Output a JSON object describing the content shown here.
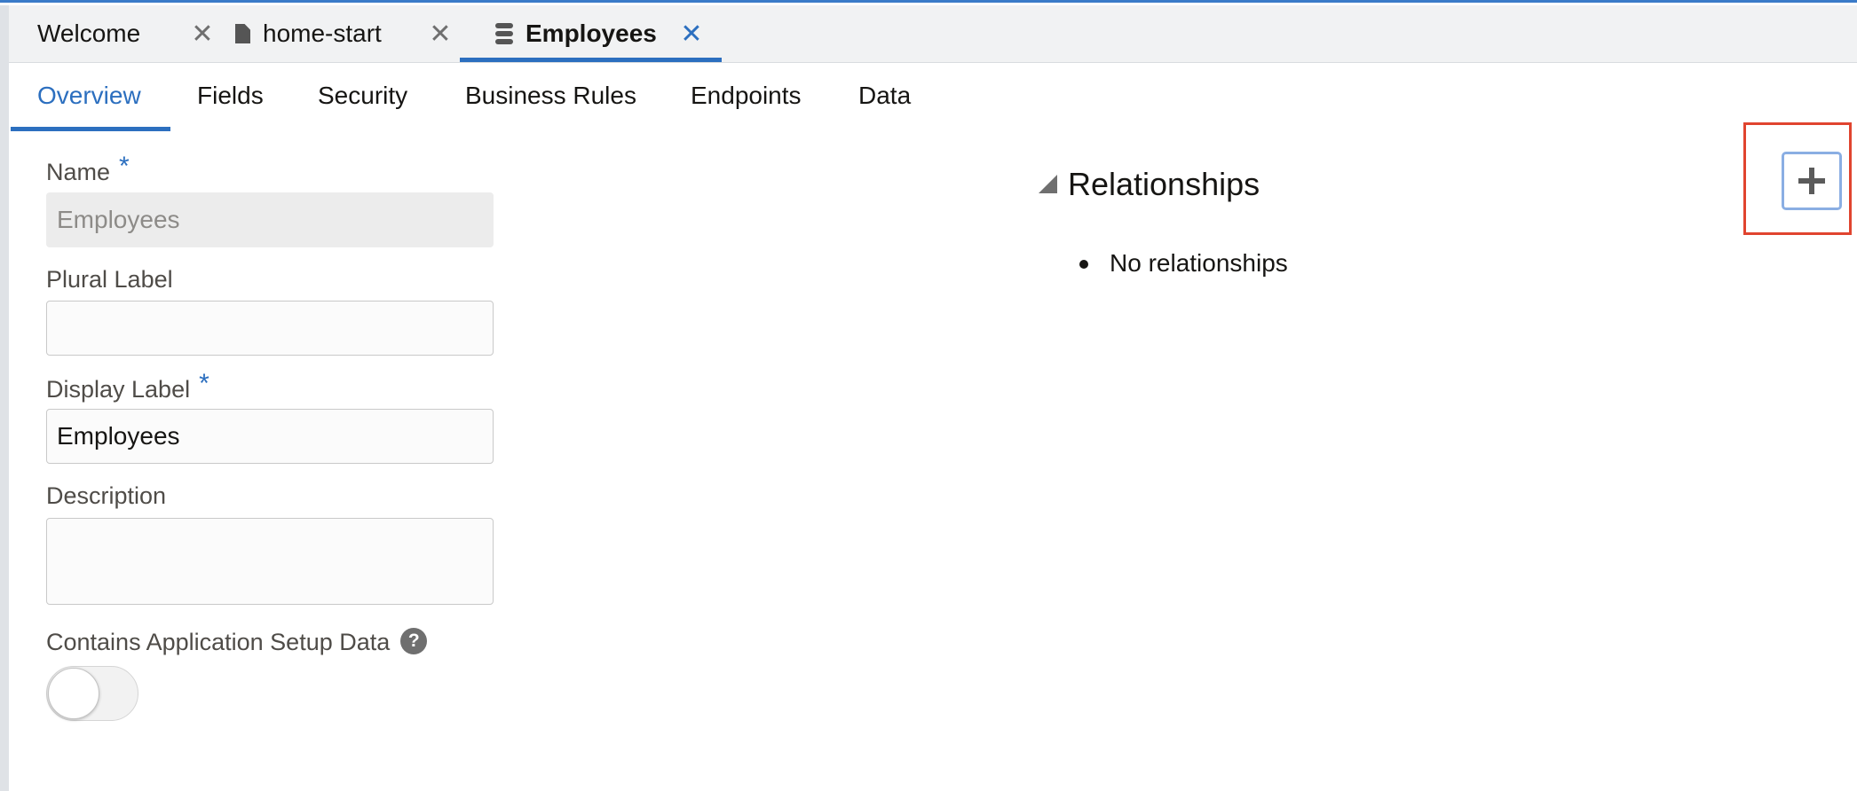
{
  "file_tabs": [
    {
      "label": "Welcome",
      "icon": null,
      "active": false
    },
    {
      "label": "home-start",
      "icon": "document-icon",
      "active": false
    },
    {
      "label": "Employees",
      "icon": "database-icon",
      "active": true
    }
  ],
  "close_glyph": "✕",
  "subtabs": [
    {
      "label": "Overview",
      "active": true
    },
    {
      "label": "Fields",
      "active": false
    },
    {
      "label": "Security",
      "active": false
    },
    {
      "label": "Business Rules",
      "active": false
    },
    {
      "label": "Endpoints",
      "active": false
    },
    {
      "label": "Data",
      "active": false
    }
  ],
  "form": {
    "name": {
      "label": "Name",
      "required_marker": "*",
      "value": "Employees",
      "readonly": true
    },
    "plural_label": {
      "label": "Plural Label",
      "value": ""
    },
    "display_label": {
      "label": "Display Label",
      "required_marker": "*",
      "value": "Employees"
    },
    "description": {
      "label": "Description",
      "value": ""
    },
    "setup_data": {
      "label": "Contains Application Setup Data",
      "help_glyph": "?",
      "toggle_on": false
    }
  },
  "relationships": {
    "title": "Relationships",
    "items": [
      "No relationships"
    ],
    "add_button_icon": "plus-icon"
  },
  "colors": {
    "accent": "#2c6fbf",
    "highlight": "#e0442f"
  }
}
